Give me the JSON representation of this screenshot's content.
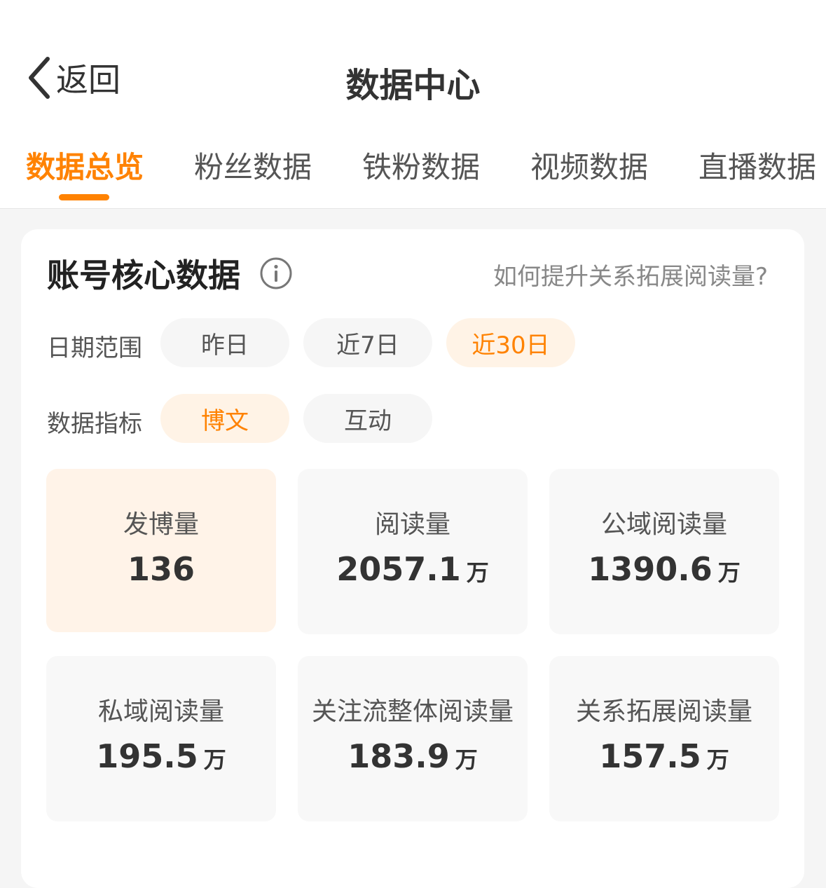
{
  "header": {
    "back_label": "返回",
    "title": "数据中心"
  },
  "tabs": [
    {
      "label": "数据总览",
      "active": true
    },
    {
      "label": "粉丝数据",
      "active": false
    },
    {
      "label": "铁粉数据",
      "active": false
    },
    {
      "label": "视频数据",
      "active": false
    },
    {
      "label": "直播数据",
      "active": false
    }
  ],
  "card": {
    "title": "账号核心数据",
    "info_icon": "info-icon",
    "help_link": "如何提升关系拓展阅读量?",
    "date_range": {
      "label": "日期范围",
      "options": [
        "昨日",
        "近7日",
        "近30日"
      ],
      "selected": "近30日"
    },
    "metric_type": {
      "label": "数据指标",
      "options": [
        "博文",
        "互动"
      ],
      "selected": "博文"
    },
    "metrics": [
      {
        "label": "发博量",
        "value": "136",
        "unit": ""
      },
      {
        "label": "阅读量",
        "value": "2057.1",
        "unit": "万"
      },
      {
        "label": "公域阅读量",
        "value": "1390.6",
        "unit": "万"
      },
      {
        "label": "私域阅读量",
        "value": "195.5",
        "unit": "万"
      },
      {
        "label": "关注流整体阅读量",
        "value": "183.9",
        "unit": "万"
      },
      {
        "label": "关系拓展阅读量",
        "value": "157.5",
        "unit": "万"
      }
    ]
  },
  "colors": {
    "accent": "#ff8200",
    "accent_bg": "#fff3e6"
  }
}
